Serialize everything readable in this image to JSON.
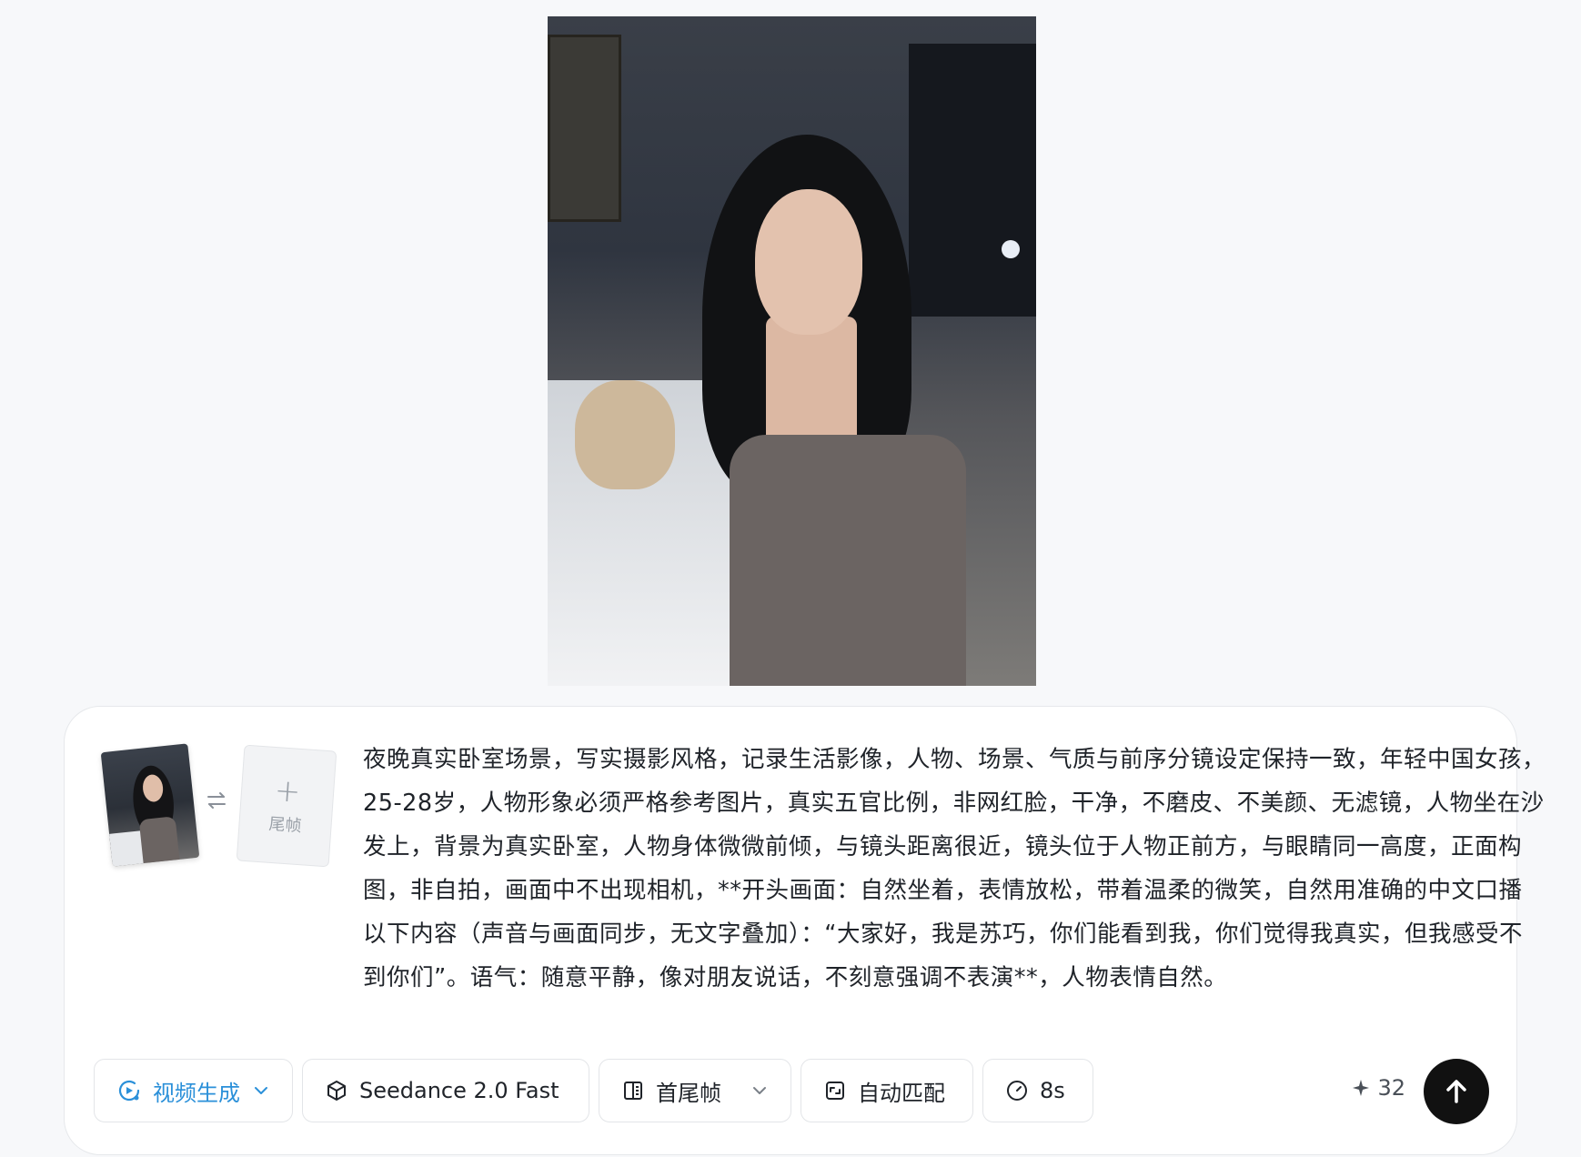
{
  "preview": {
    "alt": "Generated image of a young woman sitting in a dimly lit bedroom"
  },
  "composer": {
    "first_frame_alt": "First frame thumbnail",
    "last_frame": {
      "label": "尾帧",
      "icon": "plus-icon"
    },
    "swap_icon": "swap-horizontal-icon",
    "prompt_text": "夜晚真实卧室场景，写实摄影风格，记录生活影像，人物、场景、气质与前序分镜设定保持一致，年轻中国女孩，25-28岁，人物形象必须严格参考图片，真实五官比例，非网红脸，干净，不磨皮、不美颜、无滤镜，人物坐在沙发上，背景为真实卧室，人物身体微微前倾，与镜头距离很近，镜头位于人物正前方，与眼睛同一高度，正面构图，非自拍，画面中不出现相机，**开头画面：自然坐着，表情放松，带着温柔的微笑，自然用准确的中文口播以下内容（声音与画面同步，无文字叠加）：“大家好，我是苏巧，你们能看到我，你们觉得我真实，但我感受不到你们”。语气：随意平静，像对朋友说话，不刻意强调不表演**，人物表情自然。"
  },
  "toolbar": {
    "mode": {
      "label": "视频生成",
      "icon": "video-generate-icon",
      "color": "#2b90d9"
    },
    "model": {
      "label": "Seedance 2.0 Fast",
      "icon": "cube-icon"
    },
    "frames": {
      "label": "首尾帧",
      "icon": "frames-icon"
    },
    "ratio": {
      "label": "自动匹配",
      "icon": "aspect-ratio-icon"
    },
    "duration": {
      "label": "8s",
      "icon": "clock-icon"
    },
    "credits": {
      "value": "32",
      "icon": "sparkle-icon"
    },
    "send": {
      "icon": "arrow-up-icon"
    }
  }
}
